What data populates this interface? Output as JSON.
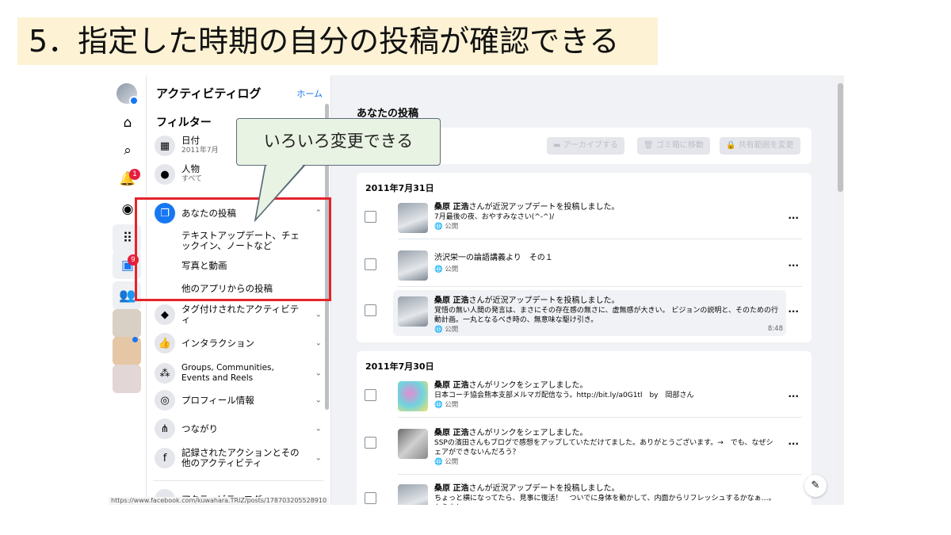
{
  "slide_title": "5．指定した時期の自分の投稿が確認できる",
  "callout": "いろいろ変更できる",
  "rail": {
    "badges": {
      "notifications": "1",
      "watch": "9"
    },
    "icons": [
      "avatar",
      "home-icon",
      "search-icon",
      "bell-icon",
      "messenger-icon",
      "grid-icon",
      "watch-icon",
      "groups-icon",
      "app-icon",
      "app-icon",
      "app-icon"
    ]
  },
  "panel": {
    "title": "アクティビティログ",
    "home_link": "ホーム",
    "filter_title": "フィルター",
    "filters": [
      {
        "label": "日付",
        "sub": "2011年7月"
      },
      {
        "label": "人物",
        "sub": "すべて"
      }
    ],
    "your_posts": {
      "label": "あなたの投稿",
      "subitems": [
        "テキストアップデート、チェックイン、ノートなど",
        "写真と動画",
        "他のアプリからの投稿"
      ]
    },
    "categories": [
      "タグ付けされたアクティビティ",
      "インタラクション",
      "Groups, Communities, Events and Reels",
      "プロフィール情報",
      "つながり",
      "記録されたアクションとその他のアクティビティ"
    ],
    "cut_item": "アクティビティログ",
    "status_url": "https://www.facebook.com/kuwahara.TRIZ/posts/178703205528910"
  },
  "main": {
    "title": "あなたの投稿",
    "toolbar": {
      "archive": "アーカイブする",
      "trash": "ゴミ箱に移動",
      "audience": "共有範囲を変更"
    },
    "groups": [
      {
        "date": "2011年7月31日",
        "entries": [
          {
            "name": "桑原 正浩",
            "action": "さんが近況アップデートを投稿しました。",
            "body": "7月最後の夜、おやすみなさい(^-^)/",
            "audience": "公開",
            "time": ""
          },
          {
            "name": "",
            "action": "渋沢栄一の論語講義より　その１",
            "body": "",
            "audience": "公開",
            "time": ""
          },
          {
            "name": "桑原 正浩",
            "action": "さんが近況アップデートを投稿しました。",
            "body": "覚悟の無い人間の発言は、まさにその存在感の無さに、虚無感が大きい。 ビジョンの説明と、そのための行動計画。一丸となるべき時の、無意味な駆け引き。",
            "audience": "公開",
            "time": "8:48"
          }
        ]
      },
      {
        "date": "2011年7月30日",
        "entries": [
          {
            "name": "桑原 正浩",
            "action": "さんがリンクをシェアしました。",
            "body": "日本コーチ協会熊本支部メルマガ配信なう。http://bit.ly/a0G1tl　by　岡部さん",
            "audience": "公開",
            "time": ""
          },
          {
            "name": "桑原 正浩",
            "action": "さんがリンクをシェアしました。",
            "body": "SSPの濱田さんもブログで感想をアップしていただけてました。ありがとうございます。→　でも、なぜシェアができないんだろう？",
            "audience": "公開",
            "time": ""
          },
          {
            "name": "桑原 正浩",
            "action": "さんが近況アップデートを投稿しました。",
            "body": "ちょっと横になってたら、見事に復活！　ついでに身体を動かして、内面からリフレッシュするかなぁ…。もう少し",
            "audience": "",
            "time": ""
          }
        ]
      }
    ]
  },
  "colors": {
    "accent": "#1877f2",
    "highlight_box": "#e5232a",
    "title_bg": "#fdf2d4",
    "callout_bg": "#e9f3e3"
  }
}
